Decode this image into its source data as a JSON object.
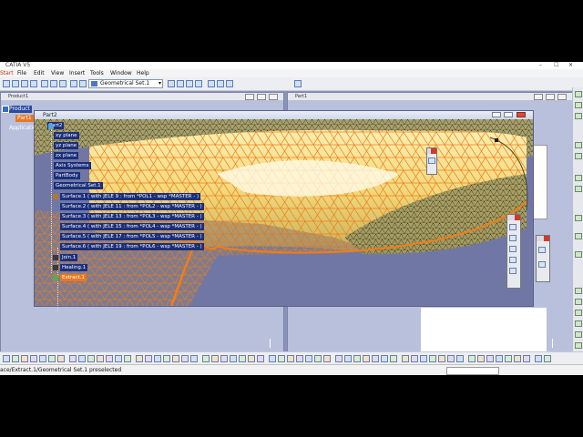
{
  "window": {
    "title": "CATIA V5",
    "min": "–",
    "max": "☐",
    "close": "✕"
  },
  "menu": [
    "Start",
    "File",
    "Edit",
    "View",
    "Insert",
    "Tools",
    "Window",
    "Help"
  ],
  "toolbar": {
    "geometrical_set": "Geometrical Set.1"
  },
  "bg_windows": {
    "product1": "Product1",
    "part1": "Part1"
  },
  "outer_tree": {
    "product": "Product",
    "part": "Part1",
    "applications": "Applications"
  },
  "part2": {
    "title": "Part2",
    "tree": [
      {
        "label": "Part2",
        "level": 0
      },
      {
        "label": "xy plane",
        "level": 1
      },
      {
        "label": "yz plane",
        "level": 1
      },
      {
        "label": "zx plane",
        "level": 1
      },
      {
        "label": "Axis Systems",
        "level": 1
      },
      {
        "label": "PartBody",
        "level": 1
      },
      {
        "label": "Geometrical Set.1",
        "level": 1
      },
      {
        "label": "Surface.1 ( with JELE 9 : from *POL1 - wsp *MASTER - )",
        "level": 2
      },
      {
        "label": "Surface.2 ( with JELE 11 : from *POL2 - wsp *MASTER - )",
        "level": 2
      },
      {
        "label": "Surface.3 ( with JELE 13 : from *POL3 - wsp *MASTER - )",
        "level": 2
      },
      {
        "label": "Surface.4 ( with JELE 15 : from *POL4 - wsp *MASTER - )",
        "level": 2
      },
      {
        "label": "Surface.5 ( with JELE 17 : from *POL5 - wsp *MASTER - )",
        "level": 2
      },
      {
        "label": "Surface.6 ( with JELE 19 : from *POL6 - wsp *MASTER - )",
        "level": 2
      },
      {
        "label": "Join.1",
        "level": 1
      },
      {
        "label": "Healing.1",
        "level": 1
      },
      {
        "label": "Extract.1",
        "level": 1,
        "selected": true
      }
    ]
  },
  "status": {
    "text": "ace/Extract.1/Geometrical Set.1 preselected"
  },
  "colors": {
    "mesh_fill": "#f5e29a",
    "mesh_edge": "#f07e18",
    "background": "#7177a5",
    "selection": "#e87820"
  }
}
